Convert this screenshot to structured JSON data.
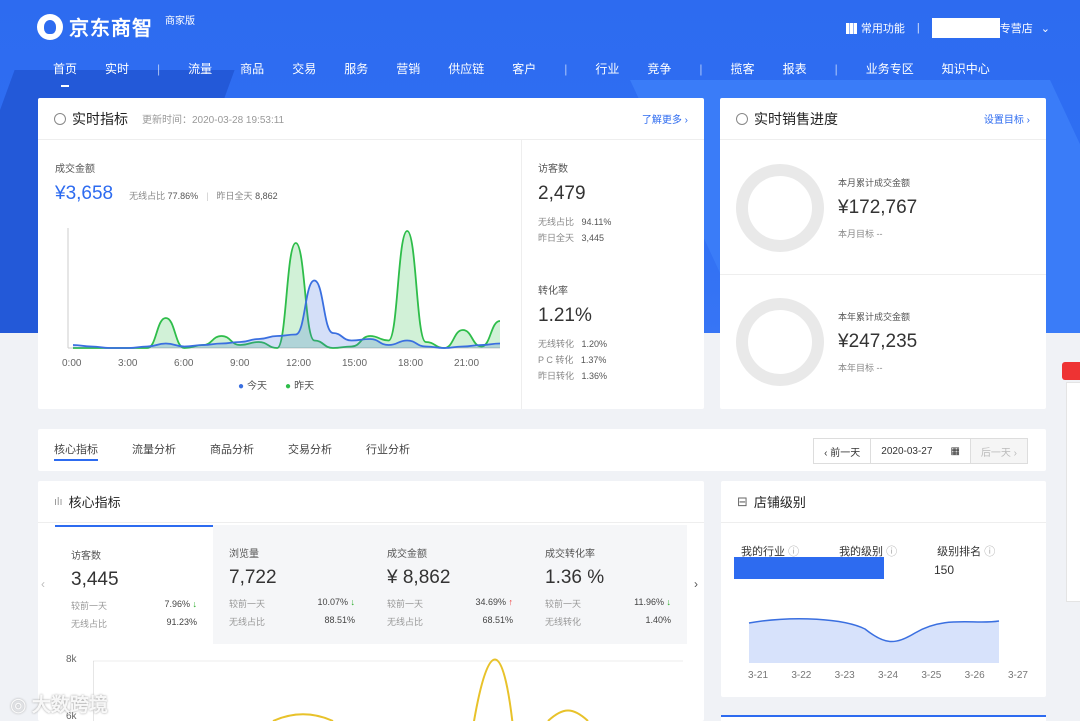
{
  "header": {
    "logo": "京东商智",
    "edition": "商家版",
    "common": "常用功能",
    "store": "专营店"
  },
  "nav": [
    "首页",
    "实时",
    "流量",
    "商品",
    "交易",
    "服务",
    "营销",
    "供应链",
    "客户",
    "行业",
    "竞争",
    "揽客",
    "报表",
    "业务专区",
    "知识中心"
  ],
  "realtime": {
    "title": "实时指标",
    "update": "更新时间：2020-03-28 19:53:11",
    "more": "了解更多 ›",
    "gmv_label": "成交金额",
    "gmv": "¥3,658",
    "wireless": "无线占比",
    "wireless_val": "77.86%",
    "yday": "昨日全天",
    "yday_val": "8,862",
    "visitors_label": "访客数",
    "visitors": "2,479",
    "v_w": "无线占比",
    "v_w_val": "94.11%",
    "v_y": "昨日全天",
    "v_y_val": "3,445",
    "conv_label": "转化率",
    "conv": "1.21%",
    "c1": "无线转化",
    "c1v": "1.20%",
    "c2": "P C 转化",
    "c2v": "1.37%",
    "c3": "昨日转化",
    "c3v": "1.36%",
    "legend_today": "今天",
    "legend_yday": "昨天"
  },
  "chart_data": {
    "type": "area",
    "x": [
      "0:00",
      "3:00",
      "6:00",
      "9:00",
      "12:00",
      "15:00",
      "18:00",
      "21:00"
    ],
    "series": [
      {
        "name": "今天",
        "color": "#3a6fe0",
        "values": [
          2,
          1,
          0,
          0,
          1,
          3,
          1,
          2,
          3,
          4,
          6,
          8,
          9,
          45,
          10,
          5,
          6,
          2,
          5,
          1,
          0,
          1,
          2,
          3
        ]
      },
      {
        "name": "昨天",
        "color": "#2ebd4a",
        "values": [
          0,
          0,
          0,
          0,
          0,
          20,
          0,
          2,
          8,
          2,
          4,
          0,
          70,
          5,
          0,
          1,
          8,
          5,
          78,
          4,
          0,
          12,
          1,
          18
        ]
      }
    ]
  },
  "sales": {
    "title": "实时销售进度",
    "set": "设置目标 ›",
    "m_label": "本月累计成交金额",
    "m_val": "¥172,767",
    "m_goal": "本月目标  --",
    "y_label": "本年累计成交金额",
    "y_val": "¥247,235",
    "y_goal": "本年目标  --"
  },
  "tabs": [
    "核心指标",
    "流量分析",
    "商品分析",
    "交易分析",
    "行业分析"
  ],
  "date": {
    "prev": "‹ 前一天",
    "date": "2020-03-27",
    "next": "后一天 ›"
  },
  "core": {
    "title": "核心指标",
    "kpis": [
      {
        "label": "访客数",
        "value": "3,445",
        "l1": "较前一天",
        "v1": "7.96%",
        "a1": "↓",
        "l2": "无线占比",
        "v2": "91.23%"
      },
      {
        "label": "浏览量",
        "value": "7,722",
        "l1": "较前一天",
        "v1": "10.07%",
        "a1": "↓",
        "l2": "无线占比",
        "v2": "88.51%"
      },
      {
        "label": "成交金额",
        "value": "¥ 8,862",
        "l1": "较前一天",
        "v1": "34.69%",
        "a1": "↑",
        "l2": "无线占比",
        "v2": "68.51%"
      },
      {
        "label": "成交转化率",
        "value": "1.36 %",
        "l1": "较前一天",
        "v1": "11.96%",
        "a1": "↓",
        "l2": "无线转化",
        "v2": "1.40%"
      }
    ],
    "y_ticks": [
      "8k",
      "6k"
    ]
  },
  "level": {
    "title": "店铺级别",
    "industry": "我的行业",
    "mylevel": "我的级别",
    "rank_label": "级别排名",
    "rank": "150",
    "dates": [
      "3-21",
      "3-22",
      "3-23",
      "3-24",
      "3-25",
      "3-26",
      "3-27"
    ]
  },
  "watermark": "大数跨境"
}
